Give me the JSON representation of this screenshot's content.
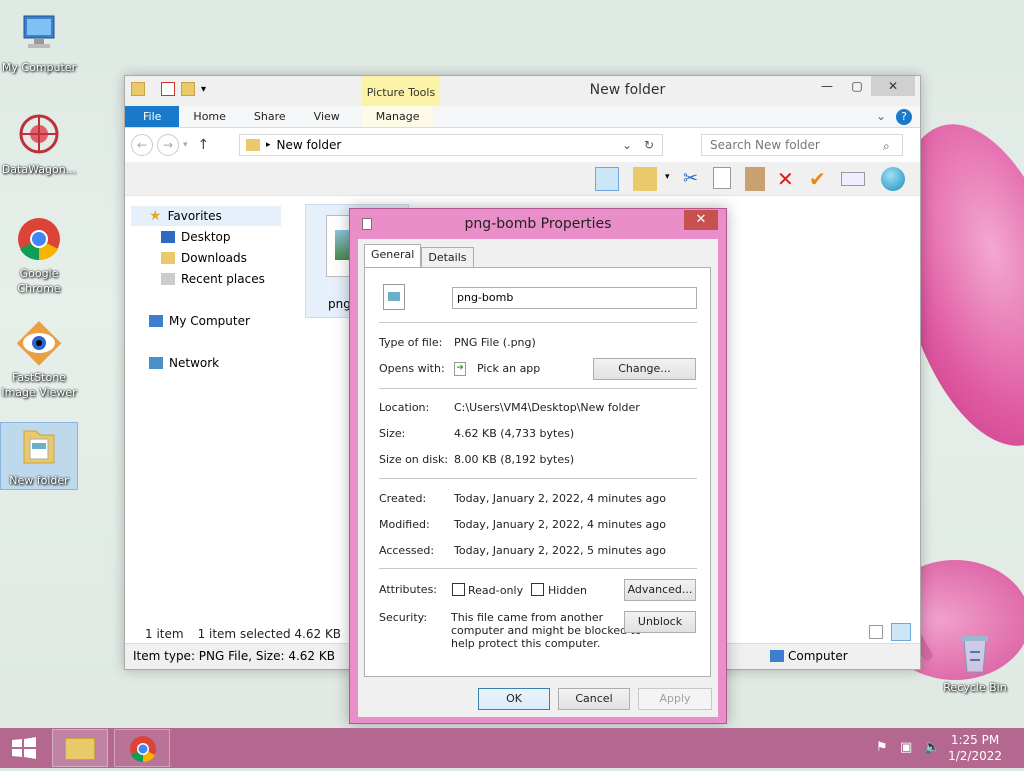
{
  "desktop": {
    "icons": [
      {
        "label": "My Computer"
      },
      {
        "label": "DataWagon..."
      },
      {
        "label": "Google Chrome"
      },
      {
        "label": "FastStone Image Viewer"
      },
      {
        "label": "New folder"
      },
      {
        "label": "Recycle Bin"
      }
    ]
  },
  "explorer": {
    "title": "New folder",
    "contextual_tab": "Picture Tools",
    "tabs": [
      "File",
      "Home",
      "Share",
      "View",
      "Manage"
    ],
    "address": "New folder",
    "search_placeholder": "Search New folder",
    "nav": {
      "favorites": "Favorites",
      "desktop": "Desktop",
      "downloads": "Downloads",
      "recent": "Recent places",
      "computer": "My Computer",
      "network": "Network"
    },
    "file_label": "png-",
    "status_count": "1 item",
    "status_selected": "1 item selected  4.62 KB",
    "details": "Item type: PNG File, Size: 4.62 KB",
    "details_right": "Computer"
  },
  "dialog": {
    "title": "png-bomb Properties",
    "tabs": [
      "General",
      "Details"
    ],
    "filename": "png-bomb",
    "type_label": "Type of file:",
    "type_value": "PNG File (.png)",
    "opens_label": "Opens with:",
    "opens_value": "Pick an app",
    "change_btn": "Change...",
    "location_label": "Location:",
    "location_value": "C:\\Users\\VM4\\Desktop\\New folder",
    "size_label": "Size:",
    "size_value": "4.62 KB (4,733 bytes)",
    "disk_label": "Size on disk:",
    "disk_value": "8.00 KB (8,192 bytes)",
    "created_label": "Created:",
    "created_value": "Today, January 2, 2022, 4 minutes ago",
    "modified_label": "Modified:",
    "modified_value": "Today, January 2, 2022, 4 minutes ago",
    "accessed_label": "Accessed:",
    "accessed_value": "Today, January 2, 2022, 5 minutes ago",
    "attributes_label": "Attributes:",
    "readonly": "Read-only",
    "hidden": "Hidden",
    "advanced_btn": "Advanced...",
    "security_label": "Security:",
    "security_text": [
      "This file came from another",
      "computer and might be blocked to",
      "help protect this computer."
    ],
    "unblock_btn": "Unblock",
    "ok": "OK",
    "cancel": "Cancel",
    "apply": "Apply"
  },
  "taskbar": {
    "time": "1:25 PM",
    "date": "1/2/2022"
  },
  "colors": {
    "accent": "#1979ca",
    "dialog_frame": "#e98ec9",
    "taskbar": "#b4688f"
  }
}
